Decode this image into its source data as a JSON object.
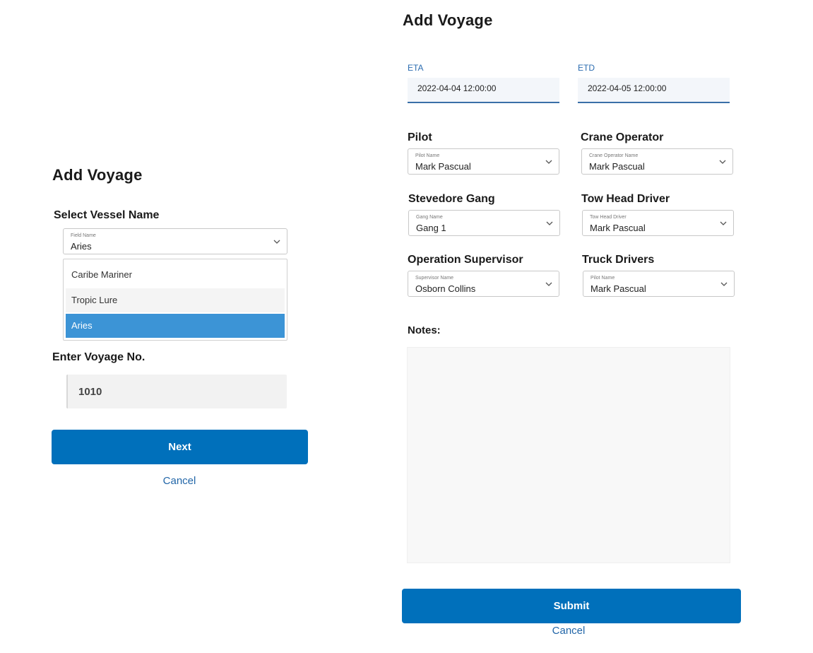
{
  "left_panel": {
    "title": "Add Voyage",
    "vessel_section_label": "Select Vessel Name",
    "vessel_select": {
      "small_label": "Field Name",
      "value": "Aries"
    },
    "vessel_options": [
      "Caribe Mariner",
      "Tropic Lure",
      "Aries"
    ],
    "selected_option": "Aries",
    "voyage_label": "Enter Voyage No.",
    "voyage_value": "1010",
    "next_button": "Next",
    "cancel_link": "Cancel"
  },
  "right_panel": {
    "title": "Add Voyage",
    "eta": {
      "label": "ETA",
      "value": "2022-04-04 12:00:00"
    },
    "etd": {
      "label": "ETD",
      "value": "2022-04-05 12:00:00"
    },
    "pilot": {
      "section": "Pilot",
      "small_label": "Pilot Name",
      "value": "Mark Pascual"
    },
    "crane_operator": {
      "section": "Crane Operator",
      "small_label": "Crane Operator Name",
      "value": "Mark Pascual"
    },
    "stevedore_gang": {
      "section": "Stevedore Gang",
      "small_label": "Gang Name",
      "value": "Gang 1"
    },
    "tow_head_driver": {
      "section": "Tow Head Driver",
      "small_label": "Tow Head Driver",
      "value": "Mark Pascual"
    },
    "operation_supervisor": {
      "section": "Operation Supervisor",
      "small_label": "Supervisor Name",
      "value": "Osborn Collins"
    },
    "truck_drivers": {
      "section": "Truck Drivers",
      "small_label": "Pilot Name",
      "value": "Mark Pascual"
    },
    "notes_label": "Notes:",
    "notes_value": "",
    "submit_button": "Submit",
    "cancel_link": "Cancel"
  },
  "colors": {
    "primary": "#0070bb",
    "selected_option": "#3c94d6",
    "date_label": "#2b6cb0",
    "link": "#2266a8"
  }
}
